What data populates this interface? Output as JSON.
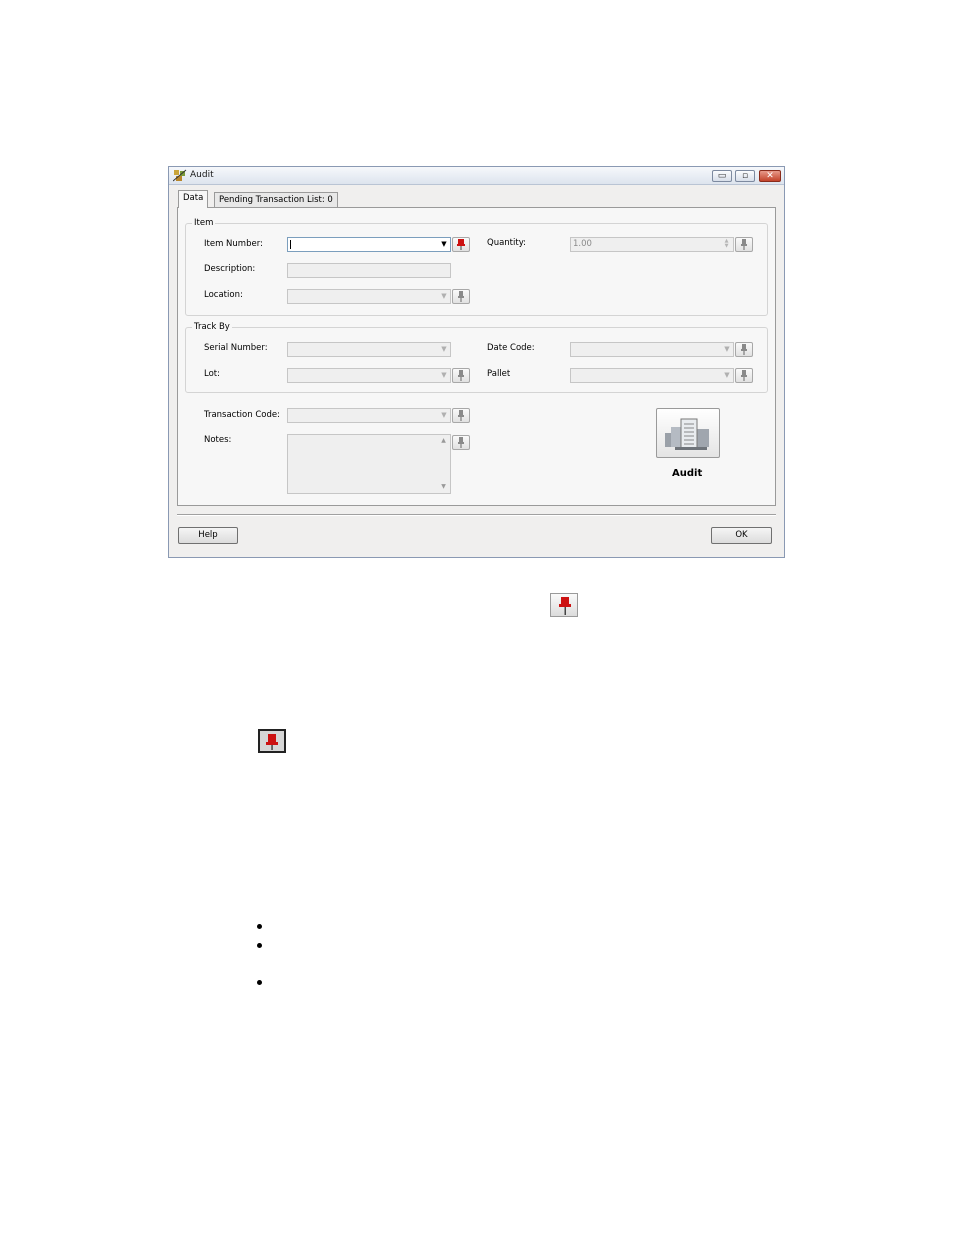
{
  "window": {
    "title": "Audit",
    "controls": {
      "minimize": "▭",
      "maximize": "▫",
      "close": "✕"
    }
  },
  "tabs": [
    {
      "label": "Data"
    },
    {
      "label": "Pending Transaction List: 0"
    }
  ],
  "item_group": {
    "title": "Item",
    "item_number_label": "Item Number:",
    "item_number_value": "",
    "description_label": "Description:",
    "location_label": "Location:",
    "quantity_label": "Quantity:",
    "quantity_value": "1.00"
  },
  "track_group": {
    "title": "Track By",
    "serial_label": "Serial Number:",
    "date_code_label": "Date Code:",
    "lot_label": "Lot:",
    "pallet_label": "Pallet"
  },
  "transaction_code_label": "Transaction Code:",
  "notes_label": "Notes:",
  "audit_button_label": "Audit",
  "help_label": "Help",
  "ok_label": "OK",
  "icons": {
    "pin_active": "pushpin-icon",
    "pin_inactive": "pushpin-icon",
    "audit": "audit-documents-icon",
    "app": "app-icon"
  },
  "colors": {
    "pin_active": "#cc1111",
    "pin_inactive": "#8a8a8a"
  }
}
